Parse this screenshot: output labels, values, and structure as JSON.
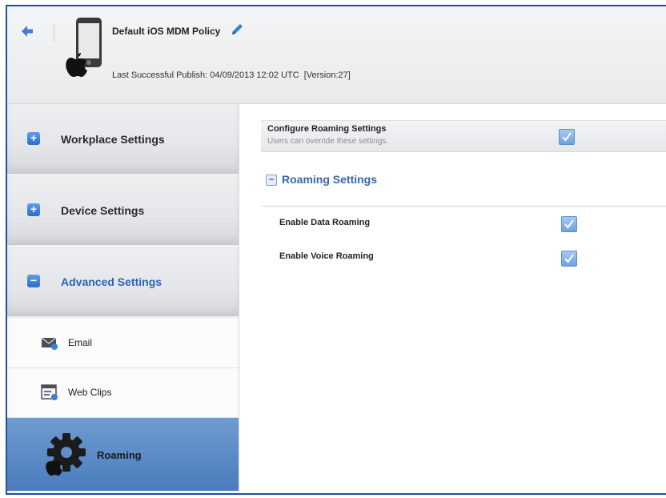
{
  "header": {
    "policy_title": "Default iOS MDM Policy",
    "publish_label": "Last Successful Publish:",
    "publish_timestamp": "04/09/2013 12:02 UTC",
    "version": "[Version:27]",
    "back_icon": "back-arrow-icon",
    "device_icon": "ios-device-icon",
    "edit_icon": "pencil-icon"
  },
  "sidebar": {
    "groups": [
      {
        "label": "Workplace Settings",
        "state": "collapsed",
        "toggle": "+"
      },
      {
        "label": "Device Settings",
        "state": "collapsed",
        "toggle": "+"
      },
      {
        "label": "Advanced Settings",
        "state": "expanded",
        "toggle": "−"
      }
    ],
    "items": [
      {
        "label": "Email",
        "icon": "email-icon"
      },
      {
        "label": "Web Clips",
        "icon": "web-clips-icon"
      },
      {
        "label": "Roaming",
        "icon": "gear-icon",
        "selected": true
      }
    ]
  },
  "main": {
    "configure": {
      "title": "Configure Roaming Settings",
      "subtitle": "Users can override these settings.",
      "checked": true
    },
    "section": {
      "title": "Roaming Settings",
      "toggle": "−",
      "options": [
        {
          "label": "Enable Data Roaming",
          "checked": true
        },
        {
          "label": "Enable Voice Roaming",
          "checked": true
        }
      ]
    }
  },
  "colors": {
    "accent": "#2c6cc9",
    "selected_bg": "#5b8bc7",
    "frame_border": "#1d4fa6",
    "section_title": "#3b66a9"
  }
}
